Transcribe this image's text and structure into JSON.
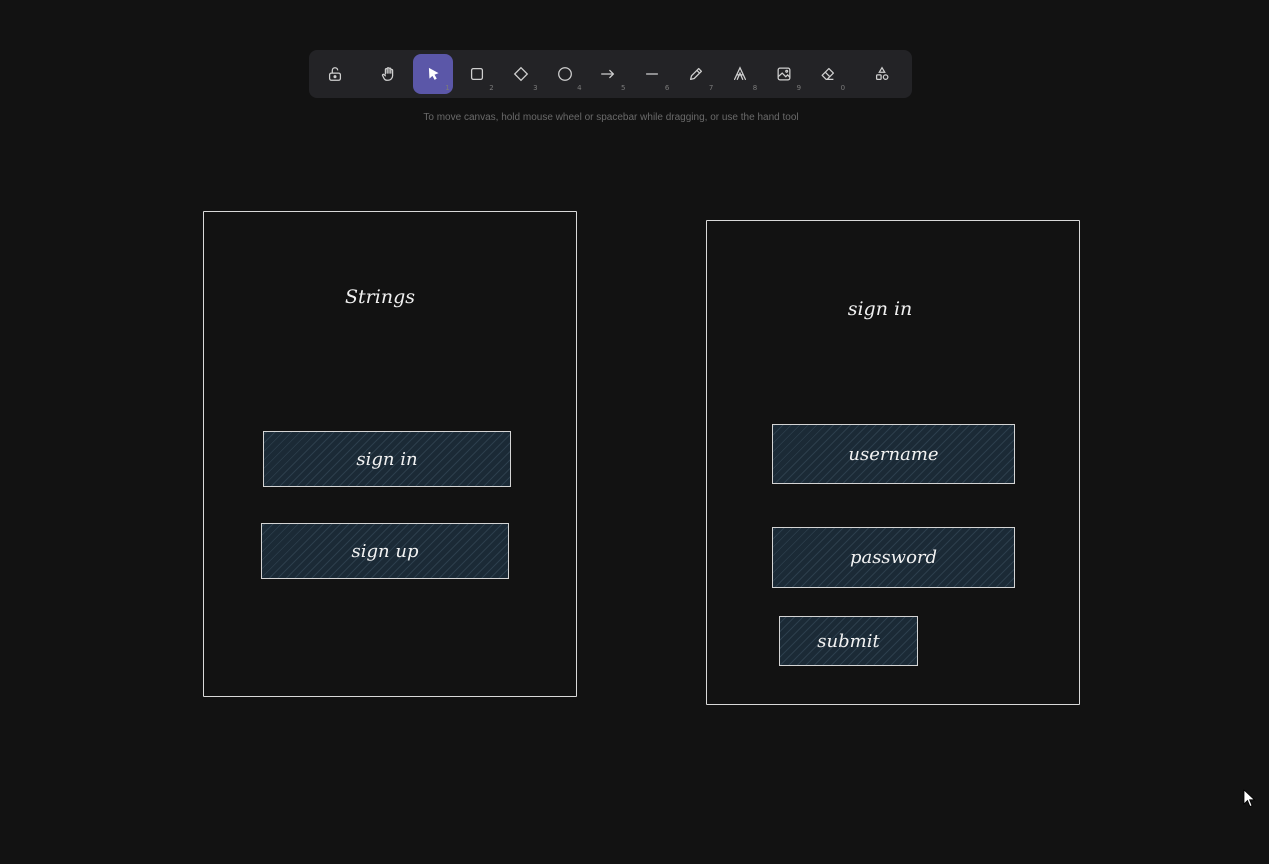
{
  "toolbar": {
    "tools": [
      {
        "name": "lock",
        "key": ""
      },
      {
        "name": "hand",
        "key": ""
      },
      {
        "name": "selection",
        "key": "1"
      },
      {
        "name": "rectangle",
        "key": "2"
      },
      {
        "name": "diamond",
        "key": "3"
      },
      {
        "name": "ellipse",
        "key": "4"
      },
      {
        "name": "arrow",
        "key": "5"
      },
      {
        "name": "line",
        "key": "6"
      },
      {
        "name": "draw",
        "key": "7"
      },
      {
        "name": "text",
        "key": "8"
      },
      {
        "name": "image",
        "key": "9"
      },
      {
        "name": "eraser",
        "key": "0"
      },
      {
        "name": "more-shapes",
        "key": ""
      }
    ],
    "active_tool": "selection"
  },
  "hint": "To move canvas, hold mouse wheel or spacebar while dragging, or use the hand tool",
  "colors": {
    "background": "#121212",
    "active_tool": "#5b57a8",
    "button_fill": "#1b2a36",
    "stroke": "#d9d9d9"
  },
  "frames": {
    "left": {
      "title": "Strings",
      "buttons": [
        "sign in",
        "sign up"
      ]
    },
    "right": {
      "title": "sign in",
      "fields": [
        "username",
        "password"
      ],
      "submit": "submit"
    }
  }
}
